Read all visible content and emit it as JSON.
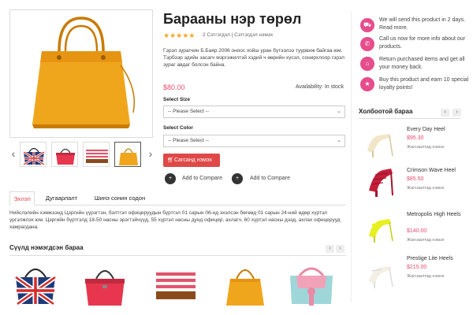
{
  "product": {
    "title": "Барааны нэр төрөл",
    "stars": "★★★★★",
    "reviews": "2 Сэтгэгдэл | Сэтгэгдэл нэмэх",
    "description": "Гэрэл зурагчин Б.Баяр 2006 оноос хойш уран бүтээлээ туурвиж байгаа юм. Тэрбээр эдийн засагч мэргэжилтэй хэдий ч өөрийн хүсэл, сонирхлоор гэрэл зураг авдаг болсон байна.",
    "price": "$80.00",
    "availability": "Availability: In stock",
    "size_label": "Select Size",
    "size_value": "-- Please Select --",
    "color_label": "Select Color",
    "color_value": "-- Please Select --",
    "cart_label": "Сагсанд нэмэх",
    "compare_1": "Add to Compare",
    "compare_2": "Add to Compare"
  },
  "tabs": [
    "Эхлэл",
    "Дугаарлалт",
    "Шинэ сонин содон"
  ],
  "tab_content": "Нийслэлийн хэмжээнд Цэргийн үүрэгтэн, бэлтгэл офицеруудын бүртгэл 01 сарын 06-нд эхэлсэн бөгөөд 01 сарын 24-ний өдөр хүртэл үргэлжлэх юм. Цэргийн бүртгэлд 18-50 насны эрэгтэйчүүд, 55 хүртэл насны дунд офицер, ахлагч, 60 хүртэл насны дээд, ахлах офицерууд хамрагдана.",
  "recent": {
    "title": "Сүүлд нэмэгдсэн бараа"
  },
  "features": [
    {
      "icon": "truck-icon",
      "text": "We will send this product in 2 days. Read more."
    },
    {
      "icon": "phone-icon",
      "text": "Call us now for more info about our products."
    },
    {
      "icon": "bank-icon",
      "text": "Return purchased items and get all your money back."
    },
    {
      "icon": "star-icon",
      "text": "Buy this product and earn 10 special loyalty points!"
    }
  ],
  "related": {
    "title": "Холбоотой бараа",
    "items": [
      {
        "name": "Every Day Heel",
        "price": "$95.30",
        "btn": "Жагсаалтад нэмэх"
      },
      {
        "name": "Crimson Wave Heel",
        "price": "$85.50",
        "btn": "Жагсаалтад нэмэх"
      },
      {
        "name": "Metropolis High Heels",
        "price": "$140.00",
        "btn": "Жагсаалтад нэмэх"
      },
      {
        "name": "Prestige Lite Heels",
        "price": "$215.00",
        "btn": "Жагсаалтад нэмэх"
      }
    ]
  },
  "colors": {
    "accent": "#e04848",
    "pink": "#e74c8c",
    "price": "#e74c6d"
  }
}
